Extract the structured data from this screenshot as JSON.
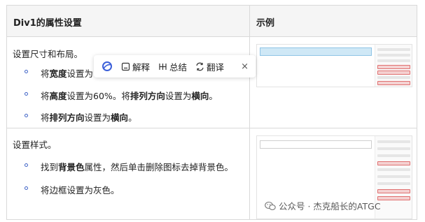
{
  "table": {
    "header": {
      "col1": "Div1的属性设置",
      "col2": "示例"
    },
    "row1": {
      "title": "设置尺寸和布局。",
      "bullets": [
        {
          "parts": [
            {
              "t": "将",
              "b": false
            },
            {
              "t": "宽度",
              "b": true
            },
            {
              "t": "设置为",
              "b": false
            }
          ]
        },
        {
          "parts": [
            {
              "t": "将",
              "b": false
            },
            {
              "t": "高度",
              "b": true
            },
            {
              "t": "设置为60%。将",
              "b": false
            },
            {
              "t": "排列方向",
              "b": true
            },
            {
              "t": "设置为",
              "b": false
            },
            {
              "t": "横向",
              "b": true
            },
            {
              "t": "。",
              "b": false
            }
          ]
        },
        {
          "parts": [
            {
              "t": "将",
              "b": false
            },
            {
              "t": "排列方向",
              "b": true
            },
            {
              "t": "设置为",
              "b": false
            },
            {
              "t": "横向",
              "b": true
            },
            {
              "t": "。",
              "b": false
            }
          ]
        }
      ]
    },
    "row2": {
      "title": "设置样式。",
      "bullets": [
        {
          "parts": [
            {
              "t": "找到",
              "b": false
            },
            {
              "t": "背景色",
              "b": true
            },
            {
              "t": "属性，然后单击删除图标去掉背景色。",
              "b": false
            }
          ]
        },
        {
          "parts": [
            {
              "t": "将边框设置为灰色。",
              "b": false
            }
          ]
        }
      ]
    }
  },
  "popup": {
    "explain": "解释",
    "summary": "总结",
    "translate": "翻译",
    "close": "×"
  },
  "watermark": {
    "text": "公众号 · 杰克船长的ATGC"
  },
  "colors": {
    "bullet": "#3f63c7",
    "logo": "#3b5fd9",
    "thumb_blue": "#cfe8f6"
  }
}
